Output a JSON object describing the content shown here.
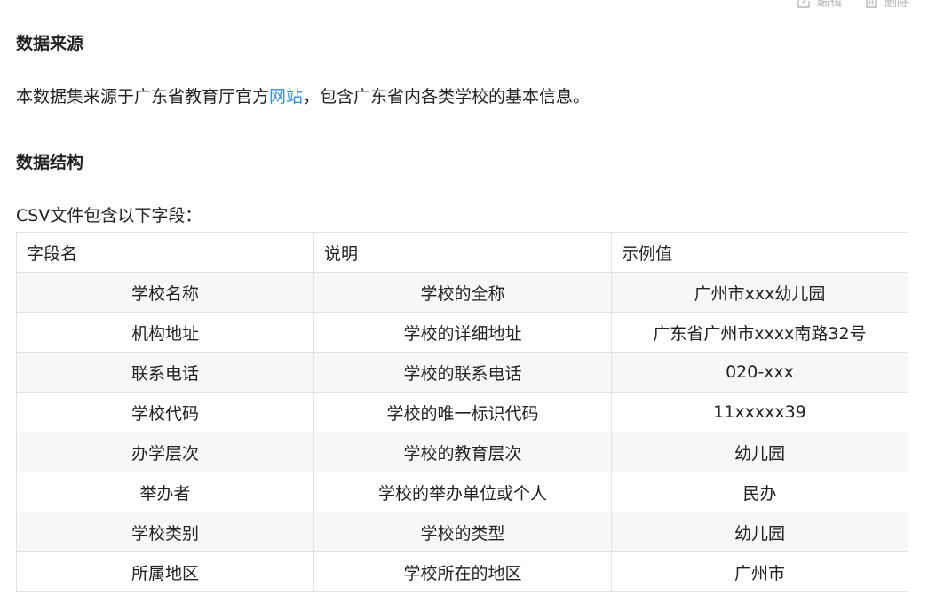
{
  "toolbar": {
    "edit_label": "编辑",
    "delete_label": "删除"
  },
  "sections": {
    "source_title": "数据来源",
    "source_text_before": "本数据集来源于广东省教育厅官方",
    "source_link": "网站",
    "source_text_after": "，包含广东省内各类学校的基本信息。",
    "structure_title": "数据结构",
    "structure_intro": "CSV文件包含以下字段："
  },
  "table": {
    "headers": [
      "字段名",
      "说明",
      "示例值"
    ],
    "rows": [
      [
        "学校名称",
        "学校的全称",
        "广州市xxx幼儿园"
      ],
      [
        "机构地址",
        "学校的详细地址",
        "广东省广州市xxxx南路32号"
      ],
      [
        "联系电话",
        "学校的联系电话",
        "020-xxx"
      ],
      [
        "学校代码",
        "学校的唯一标识代码",
        "11xxxxx39"
      ],
      [
        "办学层次",
        "学校的教育层次",
        "幼儿园"
      ],
      [
        "举办者",
        "学校的举办单位或个人",
        "民办"
      ],
      [
        "学校类别",
        "学校的类型",
        "幼儿园"
      ],
      [
        "所属地区",
        "学校所在的地区",
        "广州市"
      ]
    ]
  }
}
